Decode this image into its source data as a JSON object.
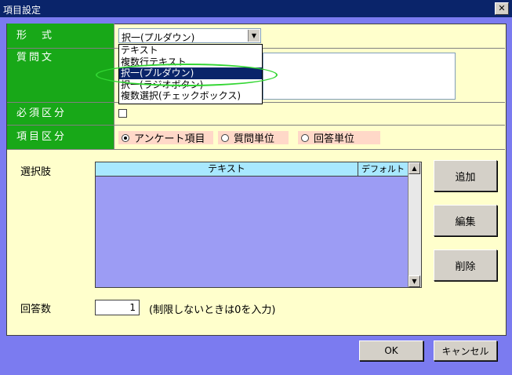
{
  "window": {
    "title": "項目設定",
    "close_glyph": "✕"
  },
  "form": {
    "format_label": "形　式",
    "question_label": "質問文",
    "required_label": "必須区分",
    "item_type_label": "項目区分",
    "format_select": {
      "value": "択一(プルダウン)",
      "options": [
        "テキスト",
        "複数行テキスト",
        "択一(プルダウン)",
        "択一(ラジオボタン)",
        "複数選択(チェックボックス)"
      ],
      "highlighted_index": 2
    },
    "required_checked": false,
    "item_type_options": [
      "アンケート項目",
      "質問単位",
      "回答単位"
    ],
    "item_type_selected": 0
  },
  "choices": {
    "label": "選択肢",
    "columns": [
      "テキスト",
      "デフォルト"
    ],
    "rows": []
  },
  "side_buttons": {
    "add": "追加",
    "edit": "編集",
    "delete": "削除"
  },
  "answers": {
    "label": "回答数",
    "value": "1",
    "note": "(制限しないときは0を入力)"
  },
  "footer": {
    "ok": "OK",
    "cancel": "キャンセル"
  },
  "colors": {
    "label_bg": "#18a818",
    "panel_bg": "#ffffcc",
    "list_bg": "#9c9cf4",
    "header_bg": "#a8e8ff",
    "titlebar": "#0a246a",
    "window_bg": "#7b7bf0"
  }
}
